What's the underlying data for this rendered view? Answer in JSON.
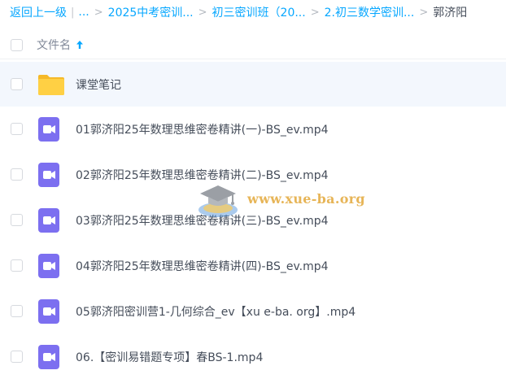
{
  "breadcrumb": {
    "back_label": "返回上一级",
    "divider": "|",
    "ellipsis": "...",
    "items": [
      "2025中考密训...",
      "初三密训班（20...",
      "2.初三数学密训...",
      "郭济阳"
    ],
    "separator": ">"
  },
  "table": {
    "header_label": "文件名",
    "sort_direction": "ascending"
  },
  "rows": [
    {
      "name": "课堂笔记",
      "type": "folder",
      "icon": "folder-icon"
    },
    {
      "name": "01郭济阳25年数理思维密卷精讲(一)-BS_ev.mp4",
      "type": "video",
      "icon": "video-file-icon"
    },
    {
      "name": "02郭济阳25年数理思维密卷精讲(二)-BS_ev.mp4",
      "type": "video",
      "icon": "video-file-icon"
    },
    {
      "name": "03郭济阳25年数理思维密卷精讲(三)-BS_ev.mp4",
      "type": "video",
      "icon": "video-file-icon"
    },
    {
      "name": "04郭济阳25年数理思维密卷精讲(四)-BS_ev.mp4",
      "type": "video",
      "icon": "video-file-icon"
    },
    {
      "name": "05郭济阳密训营1-几何综合_ev【xu e-ba. org】.mp4",
      "type": "video",
      "icon": "video-file-icon"
    },
    {
      "name": "06.【密训易错题专项】春BS-1.mp4",
      "type": "video",
      "icon": "video-file-icon"
    }
  ],
  "watermark": {
    "text": "www.xue-ba.org"
  },
  "colors": {
    "accent": "#06a7ff",
    "folder": "#ffd044",
    "video": "#7c6ff0",
    "text": "#454d5a",
    "header_text": "#818999",
    "folder_row_bg": "#f3f7fd",
    "watermark": "#e3a93b"
  }
}
